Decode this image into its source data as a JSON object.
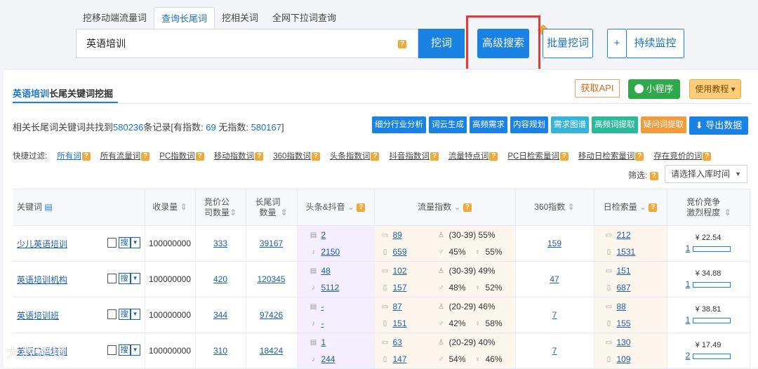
{
  "tabs": [
    "挖移动端流量词",
    "查询长尾词",
    "挖相关词",
    "全网下拉词查询"
  ],
  "search": {
    "value": "英语培训",
    "button": "挖词"
  },
  "actions": {
    "advanced": "高级搜索",
    "batch": "批量挖词",
    "plus": "+",
    "monitor": "持续监控"
  },
  "card": {
    "title_kw": "英语培训",
    "title_rest": "长尾关键词挖掘",
    "api": "获取API",
    "miniapp": "小程序",
    "tutorial": "使用教程 ▾",
    "summary": {
      "pre": "相关长尾词关键词共找到",
      "total": "580236",
      "mid": "条记录[有指数: ",
      "with": "69",
      "mid2": "  无指数: ",
      "without": "580167",
      "end": "]"
    },
    "tools": [
      {
        "label": "细分行业分析",
        "color": "#1a82e2"
      },
      {
        "label": "词云生成",
        "color": "#1a82e2"
      },
      {
        "label": "高频需求",
        "color": "#1a82e2"
      },
      {
        "label": "内容规划",
        "color": "#1a82e2"
      },
      {
        "label": "需求图谱",
        "color": "#33b3d6"
      },
      {
        "label": "高频词提取",
        "color": "#2ab99a"
      },
      {
        "label": "疑问词提取",
        "color": "#f39a3d"
      }
    ],
    "export": "导出数据",
    "filters_label": "快捷过滤:",
    "filters": [
      "所有词",
      "所有流量词",
      "PC指数词",
      "移动指数词",
      "360指数词",
      "头条指数词",
      "抖音指数词",
      "流量特点词",
      "PC日检索量词",
      "移动日检索量词",
      "存在竞价的词"
    ],
    "screen_label": "筛选:",
    "screen_select": "请选择入库时间"
  },
  "table": {
    "headers": [
      "关键词",
      "收录量",
      "竞价公司数量",
      "长尾词数量",
      "头条&抖音",
      "流量指数",
      "360指数",
      "日检索量",
      "竞价竞争激烈程度"
    ],
    "search_btn": "搜",
    "rows": [
      {
        "kw": "少儿英语培训",
        "shoulu": "100000000",
        "jingjia": "333",
        "changwei": "39167",
        "tt": "2",
        "dy": "2150",
        "pc": "89",
        "mob": "659",
        "age": "(30-39) 55%",
        "male": "45%",
        "female": "55%",
        "i360": "159",
        "day_pc": "212",
        "day_mob": "1531",
        "price": "¥ 22.54",
        "level": "1"
      },
      {
        "kw": "英语培训机构",
        "shoulu": "100000000",
        "jingjia": "420",
        "changwei": "120345",
        "tt": "48",
        "dy": "5112",
        "pc": "102",
        "mob": "157",
        "age": "(30-39) 49%",
        "male": "48%",
        "female": "52%",
        "i360": "47",
        "day_pc": "151",
        "day_mob": "687",
        "price": "¥ 34.88",
        "level": "1"
      },
      {
        "kw": "英语培训班",
        "shoulu": "100000000",
        "jingjia": "344",
        "changwei": "97426",
        "tt": "-",
        "dy": "-",
        "pc": "87",
        "mob": "151",
        "age": "(20-29) 46%",
        "male": "42%",
        "female": "58%",
        "i360": "7",
        "day_pc": "88",
        "day_mob": "155",
        "price": "¥ 38.81",
        "level": "1"
      },
      {
        "kw": "英语口语培训",
        "shoulu": "100000000",
        "jingjia": "310",
        "changwei": "18424",
        "tt": "1",
        "dy": "244",
        "pc": "63",
        "mob": "147",
        "age": "(20-29) 40%",
        "male": "54%",
        "female": "46%",
        "i360": "7",
        "day_pc": "130",
        "day_mob": "109",
        "price": "¥ 17.49",
        "level": "2"
      }
    ]
  },
  "watermark": "大数跨境"
}
